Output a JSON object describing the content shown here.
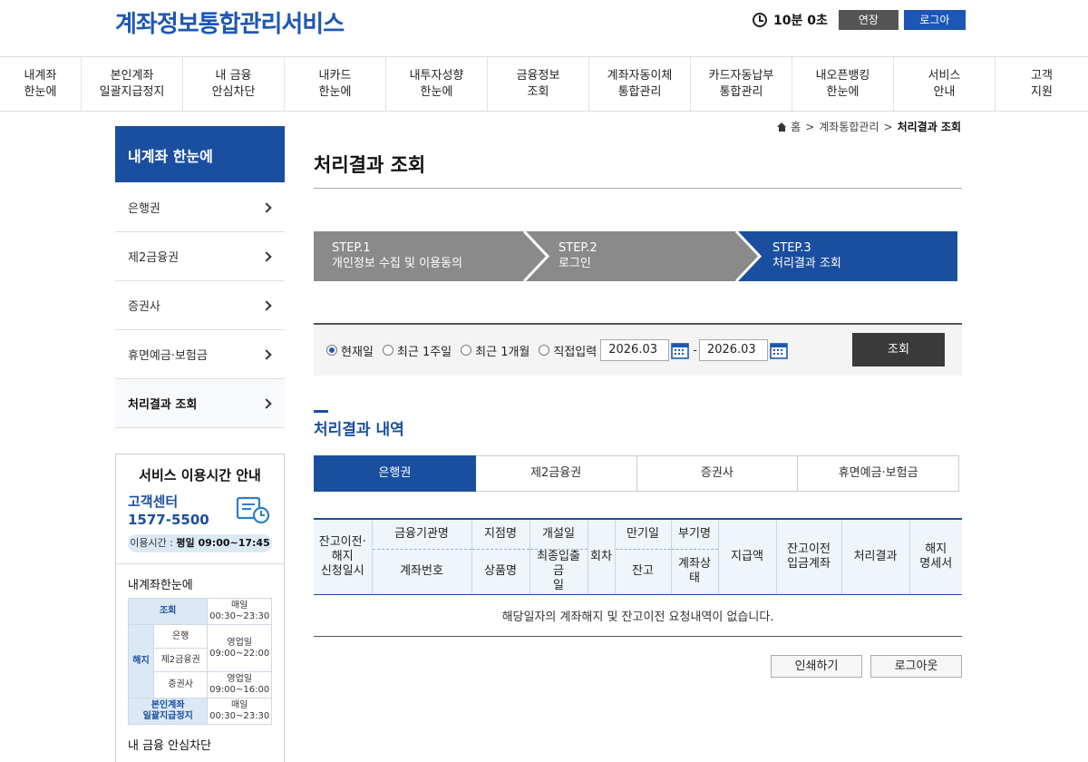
{
  "header": {
    "logo": "계좌정보통합관리서비스",
    "timer": "10분 0초",
    "extend_label": "연장",
    "logout_label": "로그아웃"
  },
  "gnb": [
    {
      "line1": "내계좌",
      "line2": "한눈에"
    },
    {
      "line1": "본인계좌",
      "line2": "일괄지급정지"
    },
    {
      "line1": "내 금융",
      "line2": "안심차단"
    },
    {
      "line1": "내카드",
      "line2": "한눈에"
    },
    {
      "line1": "내투자성향",
      "line2": "한눈에"
    },
    {
      "line1": "금융정보",
      "line2": "조회"
    },
    {
      "line1": "계좌자동이체",
      "line2": "통합관리"
    },
    {
      "line1": "카드자동납부",
      "line2": "통합관리"
    },
    {
      "line1": "내오픈뱅킹",
      "line2": "한눈에"
    },
    {
      "line1": "서비스",
      "line2": "안내"
    },
    {
      "line1": "고객",
      "line2": "지원"
    }
  ],
  "sidebar": {
    "title": "내계좌 한눈에",
    "items": [
      "은행권",
      "제2금융권",
      "증권사",
      "휴면예금·보험금",
      "처리결과 조회"
    ],
    "active_index": 4
  },
  "info": {
    "title": "서비스 이용시간 안내",
    "cs_label": "고객센터",
    "cs_phone": "1577-5500",
    "hours_prefix": "이용시간 : ",
    "hours_value": "평일 09:00~17:45",
    "section1": "내계좌한눈에",
    "section2": "내 금융 안심차단",
    "table": {
      "row1_label": "조회",
      "row1_time_a": "매일",
      "row1_time_b": "00:30~23:30",
      "cancel_label": "해지",
      "bank": "은행",
      "second": "제2금융권",
      "bank_second_time_a": "영업일",
      "bank_second_time_b": "09:00~22:00",
      "securities": "증권사",
      "securities_time_a": "영업일",
      "securities_time_b": "09:00~16:00",
      "stop_label_a": "본인계좌",
      "stop_label_b": "일괄지급정지",
      "stop_time_a": "매일",
      "stop_time_b": "00:30~23:30"
    }
  },
  "breadcrumb": {
    "home": "홈",
    "level1": "계좌통합관리",
    "current": "처리결과 조회"
  },
  "page_title": "처리결과 조회",
  "steps": [
    {
      "num": "STEP.1",
      "label": "개인정보 수집 및 이용동의"
    },
    {
      "num": "STEP.2",
      "label": "로그인"
    },
    {
      "num": "STEP.3",
      "label": "처리결과 조회"
    }
  ],
  "search": {
    "radios": [
      "현재일",
      "최근 1주일",
      "최근 1개월",
      "직접입력"
    ],
    "start_date": "2026.03",
    "end_date": "2026.03",
    "button": "조회"
  },
  "section_title": "처리결과 내역",
  "tabs": [
    "은행권",
    "제2금융권",
    "증권사",
    "휴면예금·보험금"
  ],
  "table": {
    "h_request_date": [
      "잔고이전·",
      "해지",
      "신청일시"
    ],
    "h_institution": "금융기관명",
    "h_account": "계좌번호",
    "h_branch": "지점명",
    "h_product": "상품명",
    "h_open": "개설일",
    "h_last": [
      "최종입출금",
      "일"
    ],
    "h_round": "회차",
    "h_maturity": "만기일",
    "h_balance": "잔고",
    "h_subname": "부기명",
    "h_status": [
      "계좌상",
      "태"
    ],
    "h_payout": "지급액",
    "h_transfer": [
      "잔고이전",
      "입금계좌"
    ],
    "h_result": "처리결과",
    "h_doc": [
      "해지",
      "명세서"
    ],
    "empty_message": "해당일자의 계좌해지 및 잔고이전 요청내역이 없습니다."
  },
  "buttons": {
    "print": "인쇄하기",
    "logout": "로그아웃"
  },
  "colors": {
    "brand_blue": "#1a4fa0",
    "step_gray": "#8a8a8a",
    "step_active": "#1a4fa0"
  }
}
